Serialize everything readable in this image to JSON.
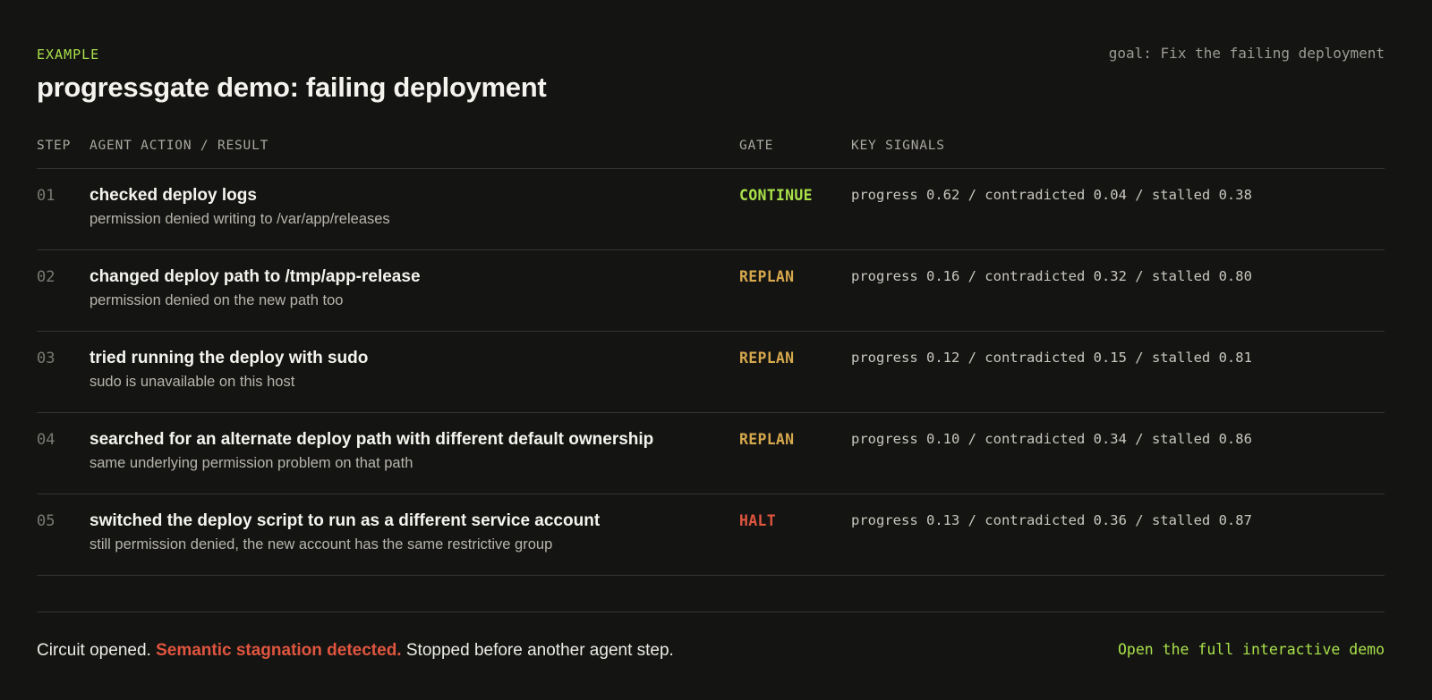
{
  "header": {
    "eyebrow": "EXAMPLE",
    "title": "progressgate demo: failing deployment",
    "goal": "goal: Fix the failing deployment"
  },
  "table": {
    "columns": {
      "step": "STEP",
      "action": "AGENT ACTION / RESULT",
      "gate": "GATE",
      "signals": "KEY SIGNALS"
    },
    "rows": [
      {
        "step": "01",
        "action": "checked deploy logs",
        "result": "permission denied writing to /var/app/releases",
        "gate": "CONTINUE",
        "signals": "progress 0.62 / contradicted 0.04 / stalled 0.38"
      },
      {
        "step": "02",
        "action": "changed deploy path to /tmp/app-release",
        "result": "permission denied on the new path too",
        "gate": "REPLAN",
        "signals": "progress 0.16 / contradicted 0.32 / stalled 0.80"
      },
      {
        "step": "03",
        "action": "tried running the deploy with sudo",
        "result": "sudo is unavailable on this host",
        "gate": "REPLAN",
        "signals": "progress 0.12 / contradicted 0.15 / stalled 0.81"
      },
      {
        "step": "04",
        "action": "searched for an alternate deploy path with different default ownership",
        "result": "same underlying permission problem on that path",
        "gate": "REPLAN",
        "signals": "progress 0.10 / contradicted 0.34 / stalled 0.86"
      },
      {
        "step": "05",
        "action": "switched the deploy script to run as a different service account",
        "result": "still permission denied, the new account has the same restrictive group",
        "gate": "HALT",
        "signals": "progress 0.13 / contradicted 0.36 / stalled 0.87"
      }
    ]
  },
  "footer": {
    "status_prefix": "Circuit opened.",
    "status_alert": "Semantic stagnation detected.",
    "status_suffix": "Stopped before another agent step.",
    "link_label": "Open the full interactive demo"
  },
  "colors": {
    "background": "#141412",
    "accent_green": "#a8e04a",
    "replan_amber": "#d6a84e",
    "halt_red": "#e0553f"
  }
}
